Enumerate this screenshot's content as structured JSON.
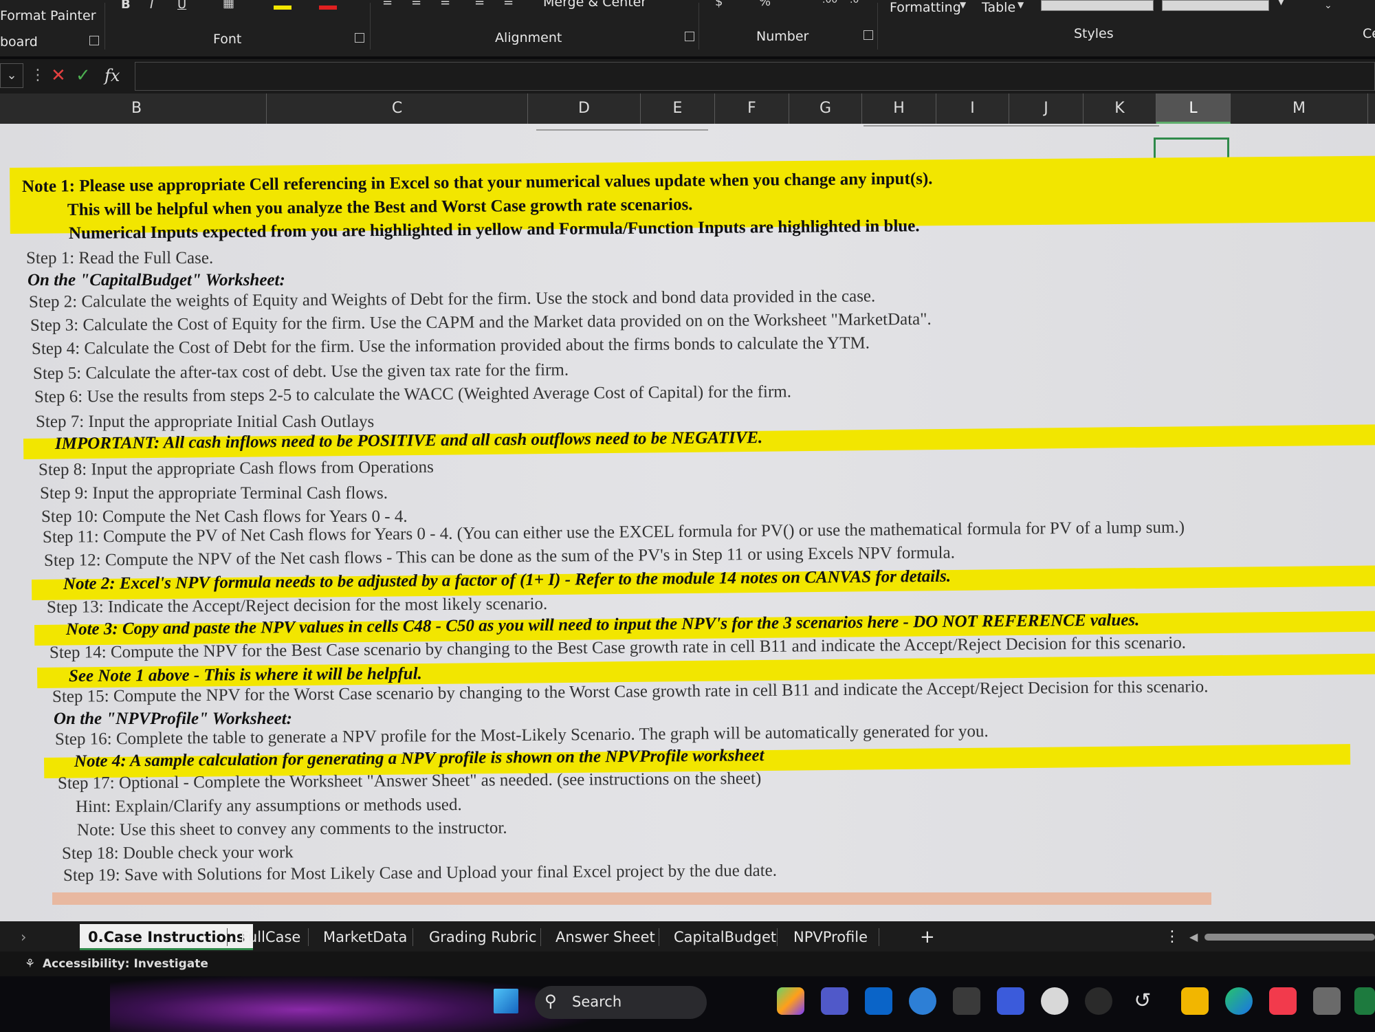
{
  "ribbon": {
    "clipboard_format_painter": "Format Painter",
    "clipboard_group": "board",
    "font_group": "Font",
    "alignment_group": "Alignment",
    "merge_center": "Merge & Center",
    "number_group": "Number",
    "number_percent": "%",
    "formatting": "Formatting",
    "table": "Table",
    "styles_group": "Styles",
    "cells_group_partial": "Ce"
  },
  "formula_bar": {
    "fx": "fx",
    "value": ""
  },
  "columns": [
    "B",
    "C",
    "D",
    "E",
    "F",
    "G",
    "H",
    "I",
    "J",
    "K",
    "L",
    "M"
  ],
  "selected_column": "L",
  "lines": [
    "Note 1: Please use appropriate Cell referencing in Excel so that your numerical values update when you change any input(s).",
    "This will be helpful when you analyze the Best and Worst Case growth rate scenarios.",
    "Numerical Inputs expected from you are highlighted in yellow and Formula/Function Inputs are highlighted in blue.",
    "Step 1: Read the Full Case.",
    "On the \"CapitalBudget\" Worksheet:",
    "Step 2: Calculate the weights of Equity and Weights of Debt for the firm. Use the stock and bond data provided in the case.",
    "Step 3: Calculate the Cost of Equity for the firm. Use the CAPM and the Market data provided on on the Worksheet \"MarketData\".",
    "Step 4: Calculate the Cost of Debt for the firm. Use the information provided about the firms bonds to calculate the YTM.",
    "Step 5: Calculate the after-tax cost of debt. Use the given tax rate for the firm.",
    "Step 6: Use the results from steps 2-5 to calculate the WACC (Weighted Average Cost of Capital) for the firm.",
    "Step 7: Input the appropriate Initial Cash Outlays",
    "IMPORTANT: All cash inflows need to be POSITIVE and all cash outflows need to be NEGATIVE.",
    "Step 8: Input the appropriate Cash flows from Operations",
    "Step 9: Input the appropriate Terminal Cash flows.",
    "Step 10: Compute the Net Cash flows for Years 0 - 4.",
    "Step 11: Compute the PV of Net Cash flows for Years 0 - 4. (You can either use the EXCEL formula for PV() or use the mathematical formula for PV of a lump sum.)",
    "Step 12: Compute the NPV of the Net cash flows - This can be done as the sum of the PV's in Step 11 or using Excels NPV formula.",
    "Note 2: Excel's NPV formula needs to be adjusted by a factor of (1+ I) - Refer to the module 14 notes on CANVAS for details.",
    "Step 13: Indicate the Accept/Reject decision for the most likely scenario.",
    "Note 3: Copy and paste the NPV values in cells C48 - C50 as you will need to input the NPV's for the 3 scenarios here - DO NOT REFERENCE values.",
    "Step 14: Compute the NPV for the Best Case scenario by changing to the Best Case growth rate in cell B11 and indicate the Accept/Reject Decision for this scenario.",
    "See Note 1 above - This is where it will be helpful.",
    "Step 15: Compute the NPV for the Worst Case scenario by changing to the Worst Case growth rate in cell B11 and indicate the Accept/Reject Decision for this scenario.",
    "On the \"NPVProfile\" Worksheet:",
    "Step 16: Complete the table to generate a NPV profile for the Most-Likely Scenario. The graph will be automatically generated for you.",
    "Note 4: A sample calculation for generating a NPV profile is shown on the NPVProfile worksheet",
    "Step 17: Optional - Complete the Worksheet \"Answer Sheet\" as needed. (see instructions on the sheet)",
    "Hint: Explain/Clarify any assumptions or methods used.",
    "Note: Use this sheet to convey any comments to the instructor.",
    "Step 18: Double check your work",
    "Step 19: Save with Solutions for Most Likely Case and Upload your final Excel project by the due date."
  ],
  "tabs": [
    "0.Case Instructions",
    "FullCase",
    "MarketData",
    "Grading Rubric",
    "Answer Sheet",
    "CapitalBudget",
    "NPVProfile"
  ],
  "active_tab": "0.Case Instructions",
  "status": {
    "accessibility": "Accessibility: Investigate"
  },
  "taskbar": {
    "search": "Search"
  },
  "colors": {
    "highlight": "#f2e600",
    "selection": "#2f8a4a"
  }
}
